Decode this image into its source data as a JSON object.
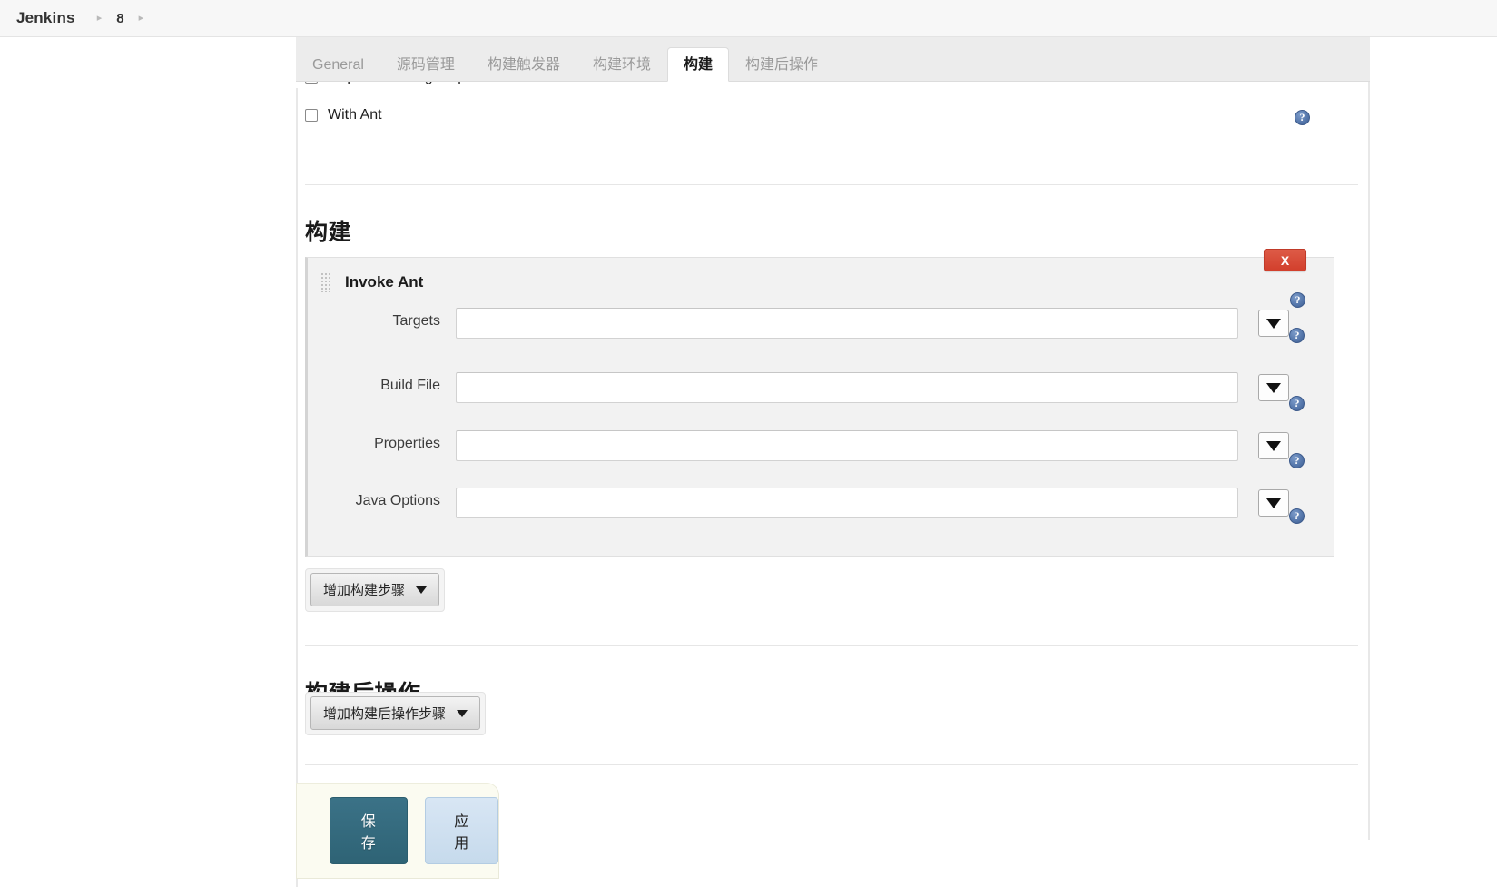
{
  "breadcrumb": {
    "root": "Jenkins",
    "separator": "▸",
    "items": [
      {
        "label": "8"
      }
    ],
    "trailing_separator": "▸"
  },
  "tabs": [
    {
      "label": "General",
      "active": false
    },
    {
      "label": "源码管理",
      "active": false
    },
    {
      "label": "构建触发器",
      "active": false
    },
    {
      "label": "构建环境",
      "active": false
    },
    {
      "label": "构建",
      "active": true
    },
    {
      "label": "构建后操作",
      "active": false
    }
  ],
  "build_env": {
    "clipped_checkbox_label": "Inspect build log for published Gradle build scans",
    "with_ant_label": "With Ant",
    "help_symbol": "?"
  },
  "build_section": {
    "heading": "构建",
    "step": {
      "title": "Invoke Ant",
      "delete_label": "X",
      "fields": [
        {
          "label": "Targets",
          "value": "",
          "placeholder": ""
        },
        {
          "label": "Build File",
          "value": "",
          "placeholder": ""
        },
        {
          "label": "Properties",
          "value": "",
          "placeholder": ""
        },
        {
          "label": "Java Options",
          "value": "",
          "placeholder": ""
        }
      ]
    },
    "add_step_button": "增加构建步骤"
  },
  "post_build_section": {
    "heading": "构建后操作",
    "add_step_button": "增加构建后操作步骤"
  },
  "actions": {
    "save_label": "保存",
    "apply_label": "应用"
  },
  "colors": {
    "accent_save": "#336b80",
    "accent_apply": "#cfe0f0",
    "danger": "#d94f3d",
    "help_blue": "#4f71a6",
    "panel_bg": "#f2f2f2",
    "tabbar_bg": "#ececec",
    "savebar_bg": "#fbfbf1"
  }
}
